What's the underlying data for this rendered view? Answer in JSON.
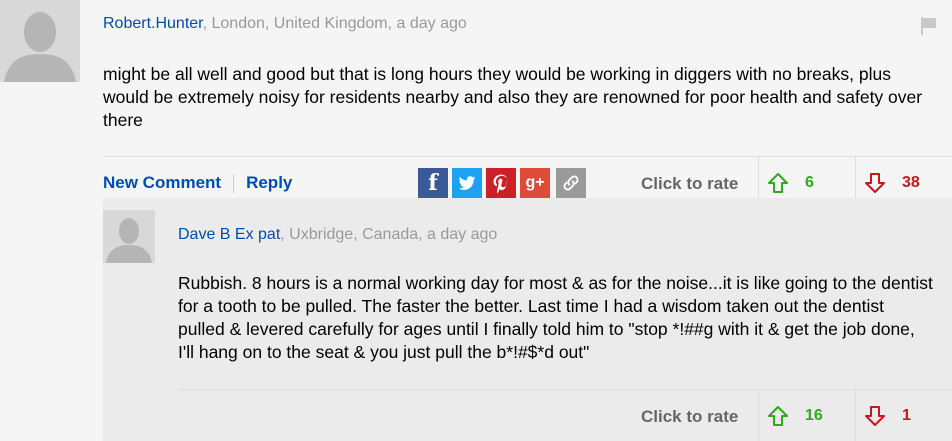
{
  "comment": {
    "author": "Robert.Hunter",
    "meta": ", London, United Kingdom, a day ago",
    "body": "might be all well and good but that is long hours they would be working in diggers with no breaks, plus would be extremely noisy for residents nearby and also they are renowned for poor health and safety over there",
    "new_comment_label": "New Comment",
    "reply_label": "Reply",
    "rate_label": "Click to rate",
    "upvotes": "6",
    "downvotes": "38"
  },
  "reply": {
    "author": "Dave B Ex pat",
    "meta": ", Uxbridge, Canada, a day ago",
    "body": "Rubbish. 8 hours is a normal working day for most & as for the noise...it is like going to the dentist for a tooth to be pulled. The faster the better. Last time I had a wisdom taken out the dentist pulled & levered carefully for ages until I finally told him to \"stop *!##g with it & get the job done, I'll hang on to the seat & you just pull the b*!#$*d out\"",
    "rate_label": "Click to rate",
    "upvotes": "16",
    "downvotes": "1"
  },
  "share": {
    "facebook_glyph": "f",
    "googleplus_glyph": "g+"
  },
  "colors": {
    "author": "#004db3",
    "upvote": "#2eaa1b",
    "downvote": "#c8161d",
    "facebook": "#3b5998",
    "twitter": "#1da1f2",
    "pinterest": "#cb2027",
    "googleplus": "#dd4b39"
  },
  "icons": [
    "avatar-silhouette",
    "flag-icon",
    "facebook-icon",
    "twitter-icon",
    "pinterest-icon",
    "google-plus-icon",
    "link-icon",
    "arrow-up-icon",
    "arrow-down-icon"
  ]
}
